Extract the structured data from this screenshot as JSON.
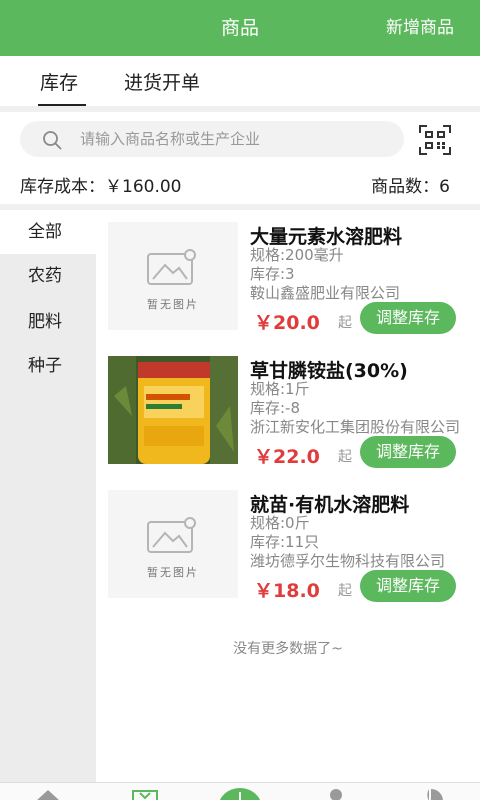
{
  "header": {
    "title": "商品",
    "action": "新增商品"
  },
  "tabs": [
    {
      "label": "库存",
      "active": true
    },
    {
      "label": "进货开单",
      "active": false
    }
  ],
  "search": {
    "placeholder": "请输入商品名称或生产企业"
  },
  "stats": {
    "cost_label": "库存成本：￥160.00",
    "count_label": "商品数：6"
  },
  "sidebar": {
    "items": [
      {
        "label": "全部",
        "active": true
      },
      {
        "label": "农药",
        "active": false
      },
      {
        "label": "肥料",
        "active": false
      },
      {
        "label": "种子",
        "active": false
      }
    ]
  },
  "products": [
    {
      "name": "大量元素水溶肥料",
      "spec": "规格:200毫升",
      "stock": "库存:3",
      "company": "鞍山鑫盛肥业有限公司",
      "price": "￥20.0",
      "unit": "起",
      "action": "调整库存",
      "image": "placeholder",
      "image_caption": "暂无图片"
    },
    {
      "name": "草甘膦铵盐(30%)",
      "spec": "规格:1斤",
      "stock": "库存:-8",
      "company": "浙江新安化工集团股份有限公司",
      "price": "￥22.0",
      "unit": "起",
      "action": "调整库存",
      "image": "photo",
      "image_caption": ""
    },
    {
      "name": "就苗·有机水溶肥料",
      "spec": "规格:0斤",
      "stock": "库存:11只",
      "company": "潍坊德孚尔生物科技有限公司",
      "price": "￥18.0",
      "unit": "起",
      "action": "调整库存",
      "image": "placeholder",
      "image_caption": "暂无图片"
    }
  ],
  "footer": {
    "no_more": "没有更多数据了~"
  },
  "colors": {
    "brand_green": "#5cb85c",
    "price_red": "#e03c3c",
    "sidebar_bg": "#ececec"
  },
  "icons": [
    "search-icon",
    "scan-qr-icon",
    "image-placeholder-icon",
    "home-icon",
    "cart-icon",
    "add-icon",
    "user-icon",
    "chart-icon"
  ]
}
